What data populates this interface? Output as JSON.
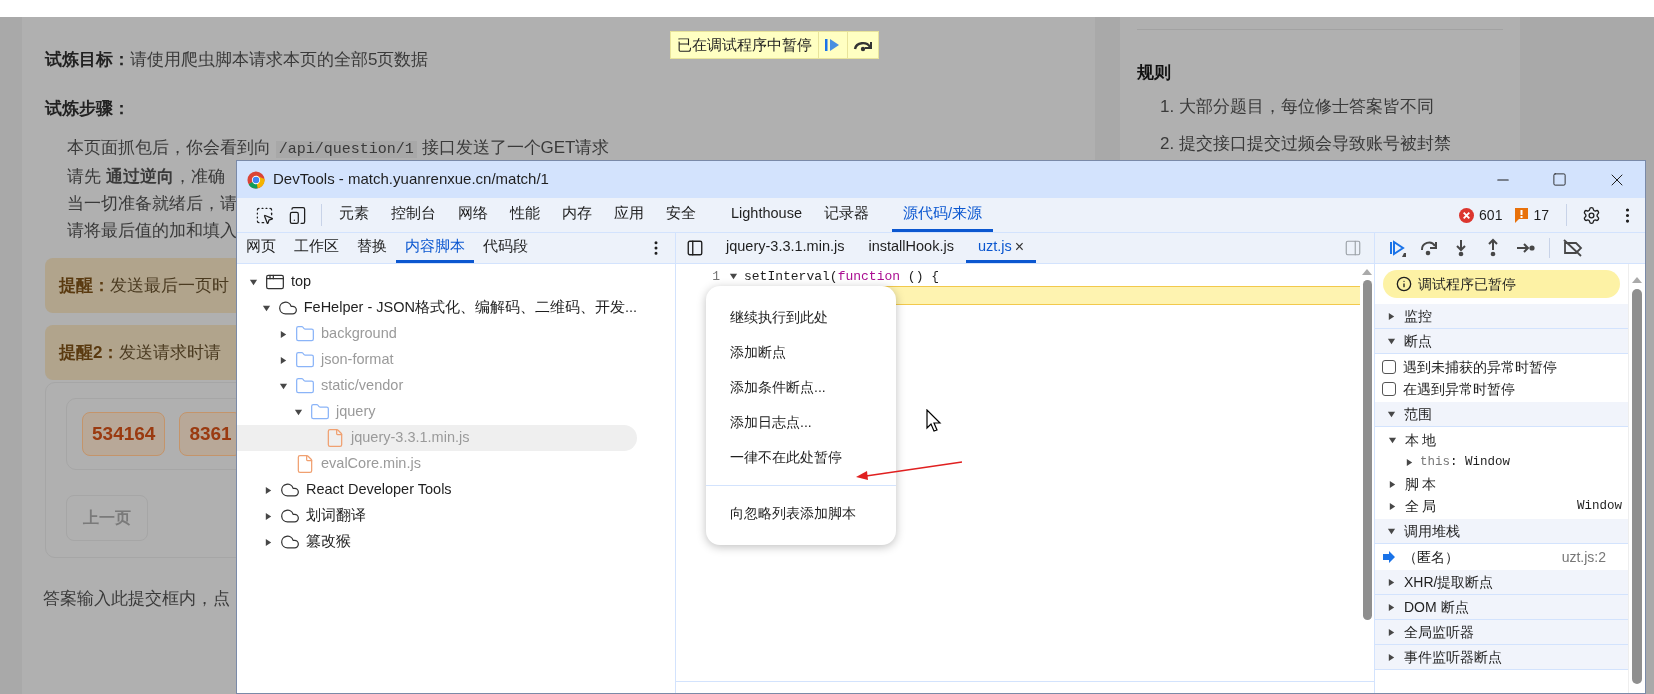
{
  "page": {
    "goal": {
      "label": "试炼目标：",
      "text": "请使用爬虫脚本请求本页的全部5页数据"
    },
    "steps_title": "试炼步骤：",
    "steps": [
      {
        "before": "本页面抓包后，你会看到向",
        "code": "/api/question/1",
        "after": "接口发送了一个GET请求"
      },
      {
        "before": "请先 **通过逆向**，准确"
      },
      {
        "before": "当一切准备就绪后，请"
      },
      {
        "before": "请将最后值的加和填入"
      }
    ],
    "tips": [
      {
        "label": "提醒：",
        "text": "发送最后一页时"
      },
      {
        "label": "提醒2：",
        "text": "发送请求时请"
      }
    ],
    "numbers": [
      "534164",
      "8361"
    ],
    "prev_button": "上一页",
    "answer_hint": "答案输入此提交框内，点"
  },
  "rules": {
    "title": "规则",
    "items": [
      "1. 大部分题目，每位修士答案皆不同",
      "2. 提交接口提交过频会导致账号被封禁"
    ]
  },
  "paused_badge": {
    "text": "已在调试程序中暂停"
  },
  "devtools": {
    "title": "DevTools - match.yuanrenxue.cn/match/1",
    "tabs": [
      {
        "label": "元素",
        "selected": false
      },
      {
        "label": "控制台",
        "selected": false
      },
      {
        "label": "网络",
        "selected": false
      },
      {
        "label": "性能",
        "selected": false
      },
      {
        "label": "内存",
        "selected": false
      },
      {
        "label": "应用",
        "selected": false
      },
      {
        "label": "安全",
        "selected": false
      },
      {
        "label": "Lighthouse",
        "selected": false
      },
      {
        "label": "记录器",
        "selected": false
      },
      {
        "label": "源代码/来源",
        "selected": true
      }
    ],
    "errors": "601",
    "warnings": "17",
    "navigator_tabs": [
      {
        "label": "网页",
        "selected": false
      },
      {
        "label": "工作区",
        "selected": false
      },
      {
        "label": "替换",
        "selected": false
      },
      {
        "label": "内容脚本",
        "selected": true
      },
      {
        "label": "代码段",
        "selected": false
      }
    ],
    "tree": [
      {
        "label": "top",
        "kind": "frame",
        "expanded": true,
        "selected": false,
        "children": [
          {
            "label": "FeHelper - JSON格式化、编解码、二维码、开发...",
            "kind": "extension",
            "expanded": true,
            "selected": false,
            "children": [
              {
                "label": "background",
                "kind": "folder",
                "expanded": false,
                "selected": false
              },
              {
                "label": "json-format",
                "kind": "folder",
                "expanded": false,
                "selected": false
              },
              {
                "label": "static/vendor",
                "kind": "folder",
                "expanded": true,
                "selected": false,
                "children": [
                  {
                    "label": "jquery",
                    "kind": "folder",
                    "expanded": true,
                    "selected": false,
                    "children": [
                      {
                        "label": "jquery-3.3.1.min.js",
                        "kind": "file",
                        "selected": true
                      }
                    ]
                  }
                ]
              },
              {
                "label": "evalCore.min.js",
                "kind": "file",
                "selected": false
              }
            ]
          },
          {
            "label": "React Developer Tools",
            "kind": "extension",
            "expanded": false,
            "selected": false
          },
          {
            "label": "划词翻译",
            "kind": "extension",
            "expanded": false,
            "selected": false
          },
          {
            "label": "篡改猴",
            "kind": "extension",
            "expanded": false,
            "selected": false
          }
        ]
      }
    ],
    "editor_tabs": [
      {
        "label": "jquery-3.3.1.min.js",
        "selected": false
      },
      {
        "label": "installHook.js",
        "selected": false
      },
      {
        "label": "uzt.js",
        "selected": true,
        "close": "×"
      }
    ],
    "code": [
      {
        "number": "1",
        "paused": false,
        "tokens": [
          {
            "kind": "plain",
            "text": "setInterval("
          },
          {
            "kind": "keyword",
            "text": "function"
          },
          {
            "kind": "plain",
            "text": " () {"
          }
        ]
      },
      {
        "paused": true
      }
    ],
    "context_menu": [
      {
        "label": "继续执行到此处",
        "kind": "item"
      },
      {
        "label": "添加断点",
        "kind": "item"
      },
      {
        "label": "添加条件断点...",
        "kind": "item"
      },
      {
        "label": "添加日志点...",
        "kind": "item"
      },
      {
        "label": "一律不在此处暂停",
        "kind": "item"
      },
      {
        "kind": "separator"
      },
      {
        "label": "向忽略列表添加脚本",
        "kind": "item"
      }
    ],
    "debugger": {
      "paused_message": "调试程序已暂停",
      "sections": [
        {
          "label": "监控",
          "expanded": false
        },
        {
          "label": "断点",
          "expanded": true,
          "checkboxes": [
            {
              "label": "遇到未捕获的异常时暂停",
              "checked": false
            },
            {
              "label": "在遇到异常时暂停",
              "checked": false
            }
          ]
        },
        {
          "label": "范围",
          "expanded": true,
          "scopes": [
            {
              "label": "本地",
              "expanded": true,
              "children": [
                {
                  "name": "this",
                  "separator": ":",
                  "value": "Window",
                  "expanded": false
                }
              ]
            },
            {
              "label": "脚本",
              "expanded": false
            },
            {
              "label": "全局",
              "expanded": false,
              "value": "Window"
            }
          ]
        },
        {
          "label": "调用堆栈",
          "expanded": true,
          "frames": [
            {
              "name": "（匿名）",
              "location": "uzt.js:2",
              "selected": true
            }
          ]
        },
        {
          "label": "XHR/提取断点",
          "expanded": false
        },
        {
          "label": "DOM 断点",
          "expanded": false
        },
        {
          "label": "全局监听器",
          "expanded": false
        },
        {
          "label": "事件监听器断点",
          "expanded": false
        }
      ]
    }
  }
}
